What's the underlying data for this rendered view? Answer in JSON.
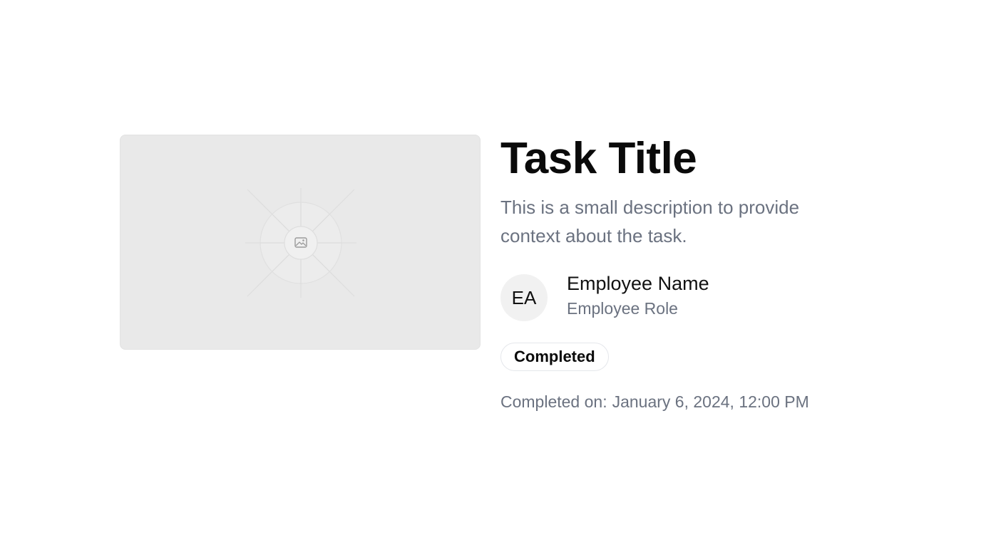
{
  "media": {
    "icon": "image-placeholder-icon"
  },
  "task": {
    "title": "Task Title",
    "description": "This is a small description to provide context about the task."
  },
  "employee": {
    "initials": "EA",
    "name": "Employee Name",
    "role": "Employee Role"
  },
  "status": {
    "label": "Completed"
  },
  "completion": {
    "label": "Completed on:",
    "datetime": "January 6, 2024, 12:00 PM"
  },
  "colors": {
    "background": "#ffffff",
    "placeholder": "#e9e9e9",
    "muted_text": "#6b7280",
    "avatar_bg": "#f1f1f1"
  }
}
